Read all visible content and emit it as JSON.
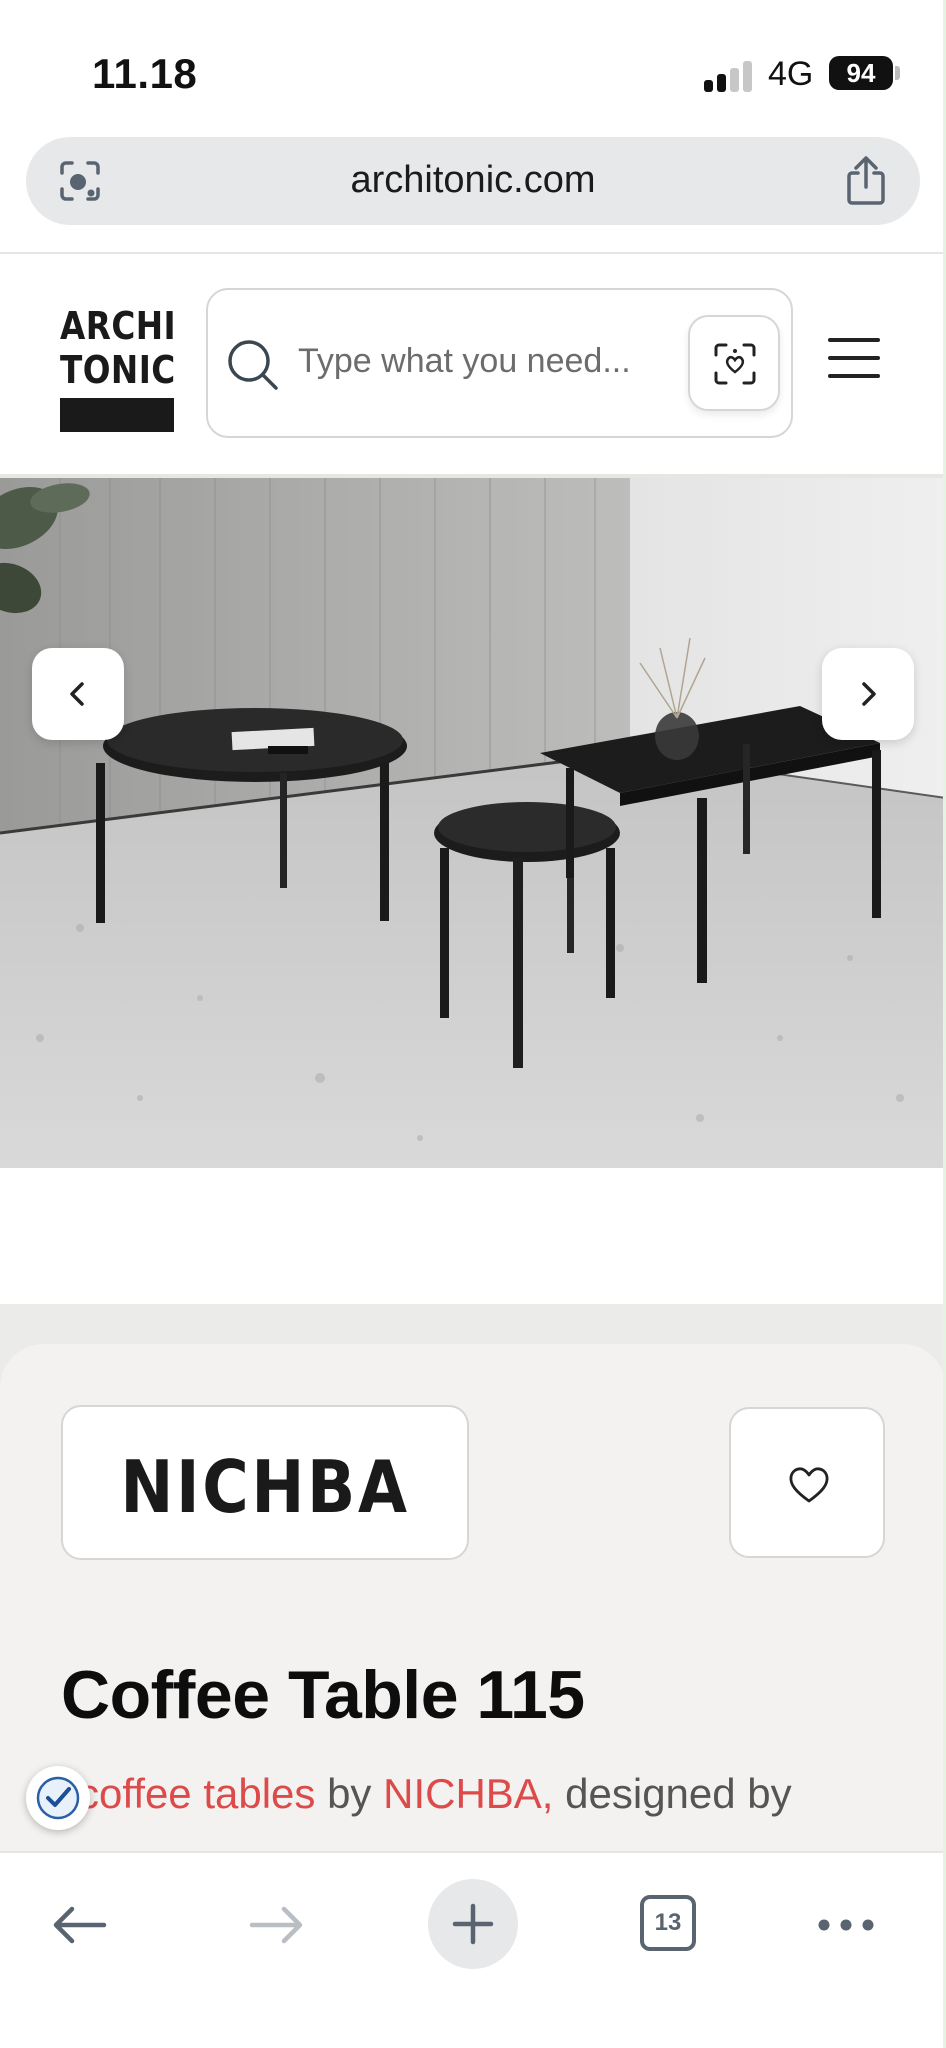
{
  "status_bar": {
    "time": "11.18",
    "network": "4G",
    "battery": "94"
  },
  "browser": {
    "url": "architonic.com",
    "tabs_count": "13"
  },
  "header": {
    "logo_line1": "ARCHI",
    "logo_line2": "TONIC",
    "search_placeholder": "Type what you need..."
  },
  "product": {
    "brand": "NICHBA",
    "title": "Coffee Table 115",
    "category_link": "coffee tables",
    "by_text": "by",
    "brand_link": "NICHBA,",
    "designed_by_text": "designed by",
    "category_prefix": "C"
  },
  "colors": {
    "accent_link": "#dc4a4a",
    "info_background": "#f3f2f0"
  },
  "icons": {
    "url_bar_left": "google-lens-icon",
    "url_bar_right": "share-icon",
    "search": "search-icon",
    "visual_search": "visual-search-icon",
    "menu": "hamburger-menu-icon",
    "carousel_prev": "chevron-left-icon",
    "carousel_next": "chevron-right-icon",
    "favorite": "heart-icon",
    "toolbar_back": "arrow-left-icon",
    "toolbar_forward": "arrow-right-icon",
    "toolbar_new_tab": "plus-icon",
    "toolbar_tabs": "tabs-icon",
    "toolbar_more": "more-icon"
  }
}
